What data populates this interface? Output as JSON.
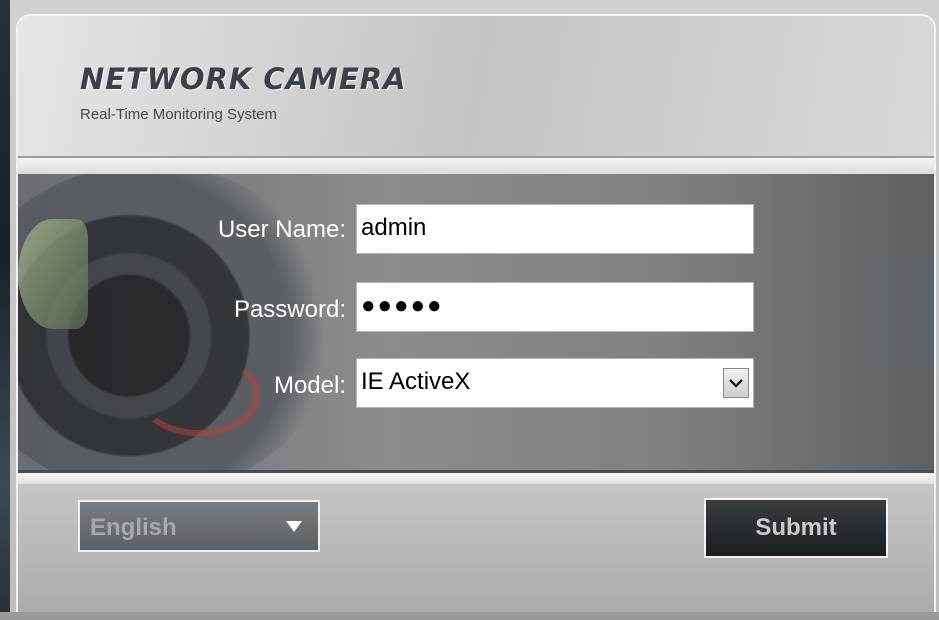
{
  "header": {
    "brand_title": "NETWORK CAMERA",
    "brand_subtitle": "Real-Time Monitoring System"
  },
  "login_form": {
    "username_label": "User Name:",
    "username_value": "admin",
    "password_label": "Password:",
    "password_value": "●●●●●",
    "model_label": "Model:",
    "model_selected": "IE ActiveX"
  },
  "footer": {
    "language_selected": "English",
    "submit_label": "Submit"
  },
  "colors": {
    "submit_bg": "#1b1e20",
    "form_bg": "#7f8183",
    "label_text": "#ffffff"
  },
  "icons": {
    "model_dropdown": "chevron-down-icon",
    "language_dropdown": "caret-down-icon"
  }
}
